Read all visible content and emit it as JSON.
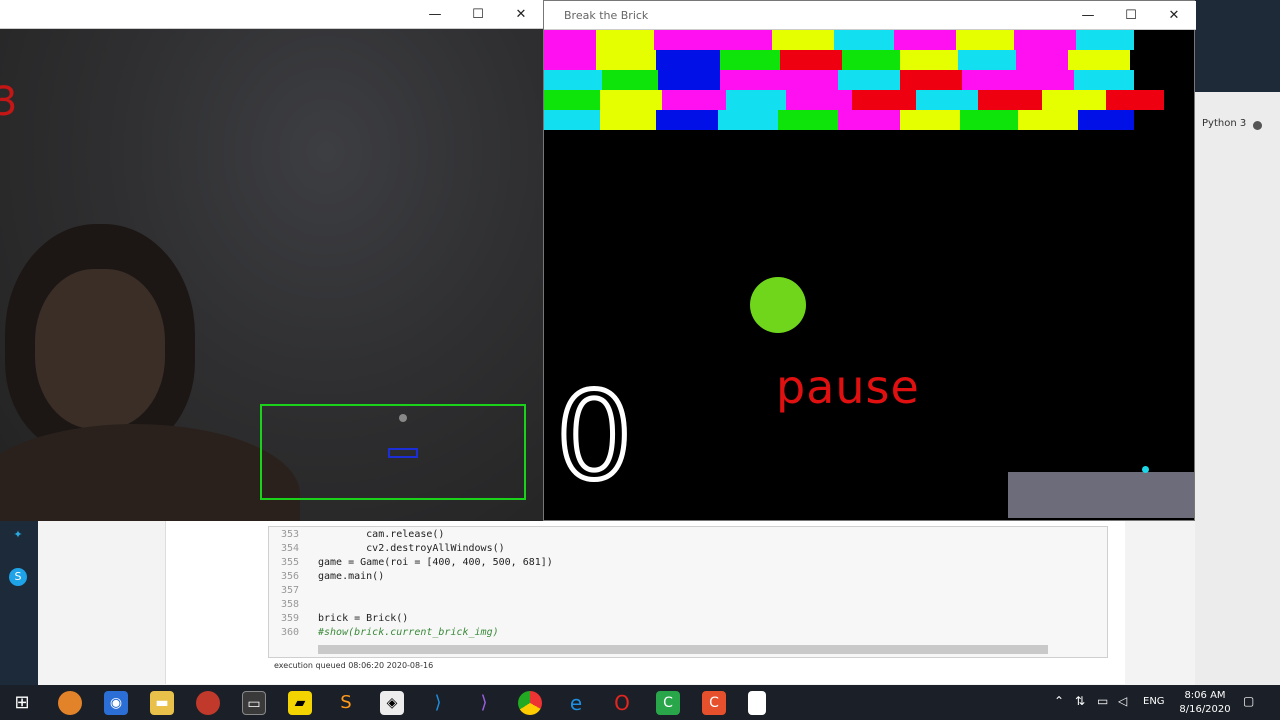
{
  "notebook": {
    "kernel": "Python 3",
    "code_lines": [
      {
        "num": "353",
        "code": "        cam.release()"
      },
      {
        "num": "354",
        "code": "        cv2.destroyAllWindows()"
      },
      {
        "num": "355",
        "code": "game = Game(roi = [400, 400, 500, 681])"
      },
      {
        "num": "356",
        "code": "game.main()"
      },
      {
        "num": "357",
        "code": ""
      },
      {
        "num": "358",
        "code": ""
      },
      {
        "num": "359",
        "code": "brick = Brick()"
      },
      {
        "num": "360",
        "code": "#show(brick.current_brick_img)"
      }
    ],
    "exec_status": "execution queued 08:06:20 2020-08-16"
  },
  "cam_window": {
    "minimize": "—",
    "maximize": "☐",
    "close": "✕",
    "red_mark": "3"
  },
  "game_window": {
    "title": "Break the Brick",
    "minimize": "—",
    "maximize": "☐",
    "close": "✕",
    "status_text": "pause",
    "score": "0",
    "colors": {
      "magenta": "#ff10f0",
      "yellow": "#e6ff00",
      "blue": "#0010e6",
      "cyan": "#12e0f0",
      "green": "#0ee40a",
      "red": "#ee0010",
      "ball": "#6fd61c",
      "paddle": "#6c6c7a"
    }
  },
  "taskbar": {
    "language": "ENG",
    "time": "8:06 AM",
    "date": "8/16/2020"
  }
}
